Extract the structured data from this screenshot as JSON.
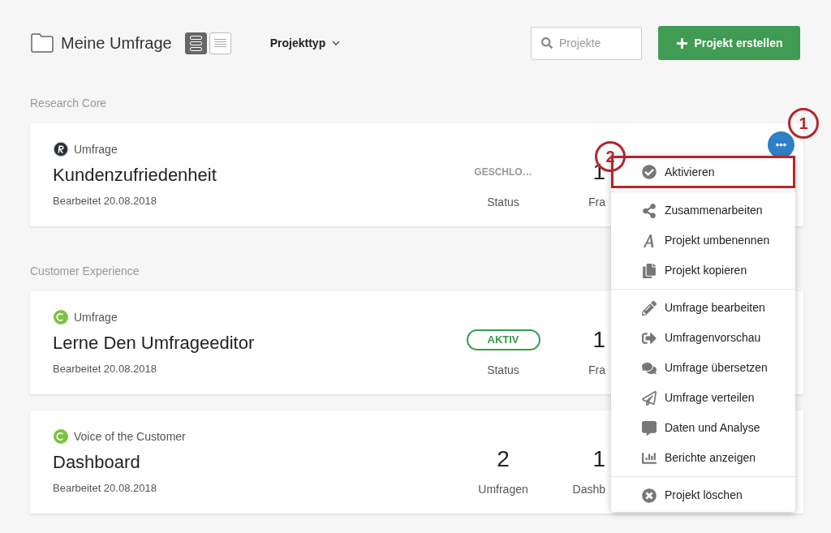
{
  "header": {
    "title": "Meine Umfrage",
    "views": [
      {
        "kind": "cards",
        "selected": true
      },
      {
        "kind": "list",
        "selected": false
      }
    ],
    "filter": "Projekttyp",
    "search": {
      "placeholder": "Projekte"
    },
    "create_button": "Projekt erstellen"
  },
  "sections": [
    {
      "label": "Research Core",
      "cards": [
        {
          "kind": "core",
          "type": "Umfrage",
          "title": "Kundenzufriedenheit",
          "edited": "Bearbeitet 20.08.2018",
          "stats": [
            {
              "kind": "status",
              "active": false,
              "value": "GESCHLO…",
              "label": "Status"
            },
            {
              "kind": "number",
              "value": "1",
              "label": "Fra"
            }
          ]
        }
      ]
    },
    {
      "label": "Customer Experience",
      "cards": [
        {
          "kind": "experience",
          "type": "Umfrage",
          "title": "Lerne Den Umfrageeditor",
          "edited": "Bearbeitet 20.08.2018",
          "stats": [
            {
              "kind": "status",
              "active": true,
              "value": "AKTIV",
              "label": "Status"
            },
            {
              "kind": "number",
              "value": "1",
              "label": "Fra"
            }
          ]
        },
        {
          "kind": "experience",
          "type": "Voice of the Customer",
          "title": "Dashboard",
          "edited": "Bearbeitet 20.08.2018",
          "stats": [
            {
              "kind": "number",
              "value": "2",
              "label": "Umfragen"
            },
            {
              "kind": "number",
              "value": "1",
              "label": "Dashb"
            }
          ]
        }
      ]
    }
  ],
  "menu": {
    "groups": [
      [
        {
          "label": "Aktivieren",
          "highlighted": true
        }
      ],
      [
        {
          "label": "Zusammenarbeiten",
          "highlighted": false
        },
        {
          "label": "Projekt umbenennen",
          "highlighted": false
        },
        {
          "label": "Projekt kopieren",
          "highlighted": false
        }
      ],
      [
        {
          "label": "Umfrage bearbeiten",
          "highlighted": false
        },
        {
          "label": "Umfragenvorschau",
          "highlighted": false
        },
        {
          "label": "Umfrage übersetzen",
          "highlighted": false
        },
        {
          "label": "Umfrage verteilen",
          "highlighted": false
        },
        {
          "label": "Daten und Analyse",
          "highlighted": false
        },
        {
          "label": "Berichte anzeigen",
          "highlighted": false
        }
      ],
      [
        {
          "label": "Projekt löschen",
          "highlighted": false
        }
      ]
    ]
  },
  "callouts": [
    "1",
    "2"
  ]
}
